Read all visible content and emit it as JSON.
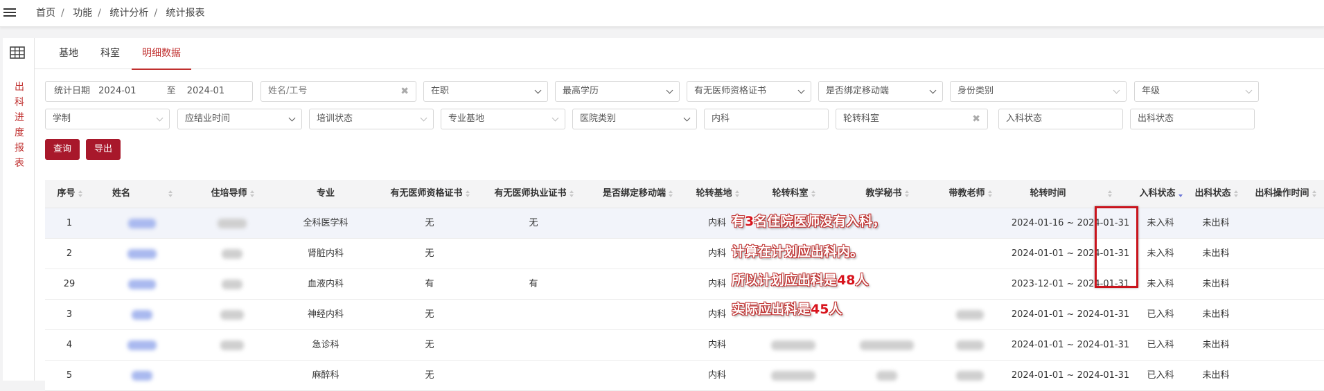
{
  "breadcrumb": [
    "首页",
    "功能",
    "统计分析",
    "统计报表"
  ],
  "breadcrumb_sep": "/",
  "sidebar_title": "出科进度报表",
  "tabs": [
    "基地",
    "科室",
    "明细数据"
  ],
  "active_tab": 2,
  "filters": {
    "date_label": "统计日期",
    "date_from": "2024-01",
    "date_to_label": "至",
    "date_to": "2024-01",
    "name_placeholder": "姓名/工号",
    "status": "在职",
    "education": "最高学历",
    "physician_cert": "有无医师资格证书",
    "mobile_bind": "是否绑定移动端",
    "identity": "身份类别",
    "grade": "年级",
    "schooling": "学制",
    "graduation_time": "应结业时间",
    "training_status": "培训状态",
    "specialty_base": "专业基地",
    "hospital_type": "医院类别",
    "department": "内科",
    "rotation_dept": "轮转科室",
    "entry_status": "入科状态",
    "exit_status": "出科状态"
  },
  "buttons": {
    "query": "查询",
    "export": "导出"
  },
  "columns": [
    "序号",
    "姓名",
    "住培导师",
    "专业",
    "有无医师资格证书",
    "有无医师执业证书",
    "是否绑定移动端",
    "轮转基地",
    "轮转科室",
    "教学秘书",
    "带教老师",
    "轮转时间",
    "入科状态",
    "出科状态",
    "出科操作时间"
  ],
  "rows": [
    {
      "seq": "1",
      "major": "全科医学科",
      "qual_cert": "无",
      "practice_cert": "无",
      "base": "内科",
      "time": "2024-01-16 ~ 2024-01-31",
      "entry": "未入科",
      "exit": "未出科"
    },
    {
      "seq": "2",
      "major": "肾脏内科",
      "qual_cert": "无",
      "practice_cert": "",
      "base": "内科",
      "time": "2024-01-01 ~ 2024-01-31",
      "entry": "未入科",
      "exit": "未出科"
    },
    {
      "seq": "29",
      "major": "血液内科",
      "qual_cert": "有",
      "practice_cert": "有",
      "base": "内科",
      "time": "2023-12-01 ~ 2024-01-31",
      "entry": "未入科",
      "exit": "未出科"
    },
    {
      "seq": "3",
      "major": "神经内科",
      "qual_cert": "无",
      "practice_cert": "",
      "base": "内科",
      "time": "2024-01-01 ~ 2024-01-31",
      "entry": "已入科",
      "exit": "未出科"
    },
    {
      "seq": "4",
      "major": "急诊科",
      "qual_cert": "无",
      "practice_cert": "",
      "base": "内科",
      "time": "2024-01-01 ~ 2024-01-31",
      "entry": "已入科",
      "exit": "未出科"
    },
    {
      "seq": "5",
      "major": "麻醉科",
      "qual_cert": "无",
      "practice_cert": "",
      "base": "内科",
      "time": "2024-01-01 ~ 2024-01-31",
      "entry": "已入科",
      "exit": "未出科"
    }
  ],
  "annotation": {
    "line1": [
      "有",
      "3",
      "名住院医师没有入科，"
    ],
    "line2": "计算在计划应出科内。",
    "line3": [
      "所以计划应出科是",
      "48",
      "人"
    ],
    "line4": [
      "实际应出科是",
      "45",
      "人"
    ],
    "box_color": "#c9141d"
  },
  "colors": {
    "accent": "#c0302f",
    "button": "#a8182b"
  }
}
